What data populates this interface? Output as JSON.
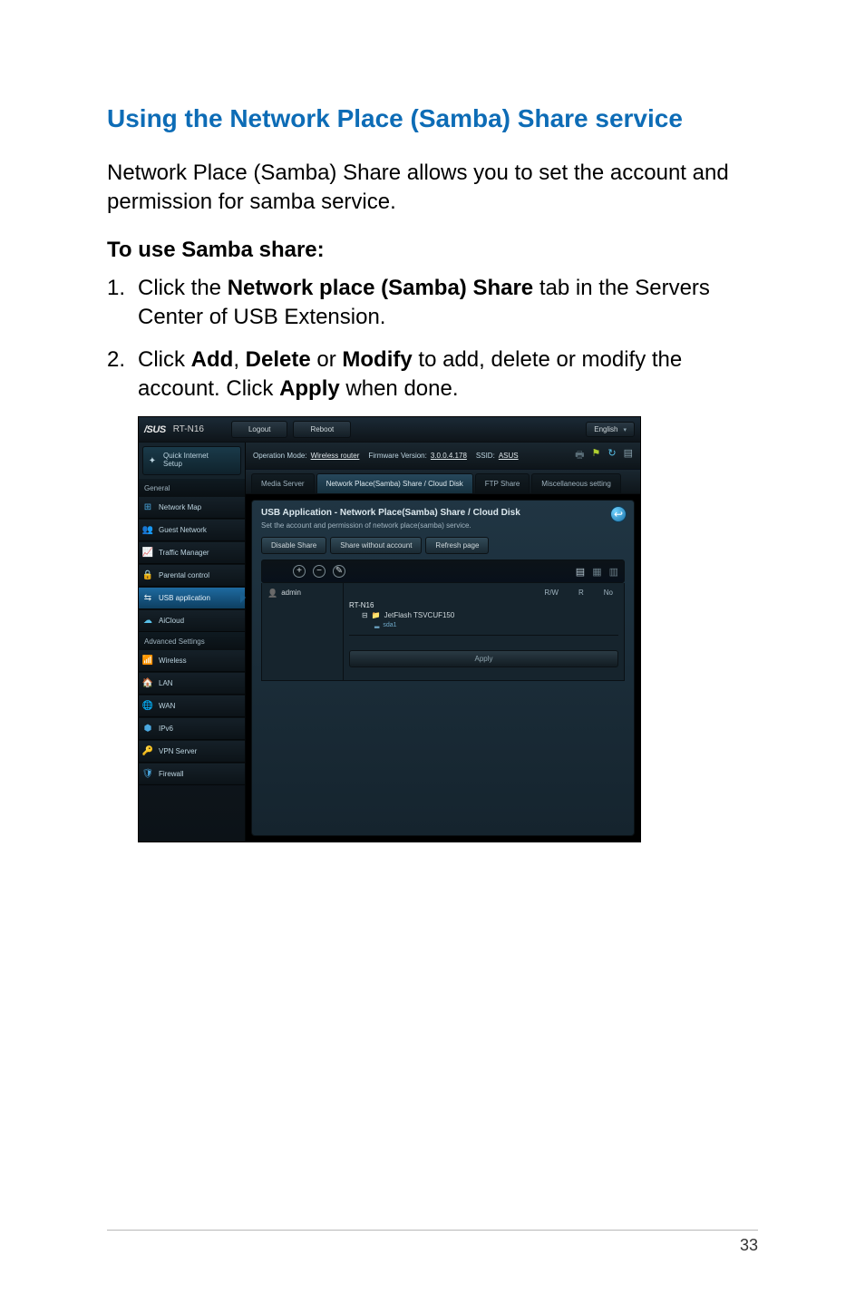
{
  "doc": {
    "section_title": "Using the Network Place (Samba) Share service",
    "intro": "Network Place (Samba) Share allows you to set the account and permission for samba service.",
    "subhead": "To use Samba share:",
    "step1_num": "1.",
    "step1_a": "Click the ",
    "step1_b": "Network place (Samba) Share",
    "step1_c": " tab in the Servers Center of USB Extension.",
    "step2_num": "2.",
    "step2_a": "Click ",
    "step2_add": "Add",
    "step2_comma1": ", ",
    "step2_del": "Delete",
    "step2_or": " or ",
    "step2_mod": "Modify",
    "step2_b": " to add, delete or modify the account. Click ",
    "step2_apply": "Apply",
    "step2_c": " when done.",
    "page_number": "33"
  },
  "ui": {
    "brand": "/SUS",
    "model": "RT-N16",
    "btn_logout": "Logout",
    "btn_reboot": "Reboot",
    "lang": "English",
    "info_opmode_label": "Operation Mode: ",
    "info_opmode_value": "Wireless router",
    "info_fw_label": "Firmware Version: ",
    "info_fw_value": "3.0.0.4.178",
    "info_ssid_label": "SSID: ",
    "info_ssid_value": "ASUS",
    "qis_l1": "Quick Internet",
    "qis_l2": "Setup",
    "hdr_general": "General",
    "nav_map": "Network Map",
    "nav_guest": "Guest Network",
    "nav_traffic": "Traffic Manager",
    "nav_parental": "Parental control",
    "nav_usb": "USB application",
    "nav_aicloud": "AiCloud",
    "hdr_adv": "Advanced Settings",
    "nav_wireless": "Wireless",
    "nav_lan": "LAN",
    "nav_wan": "WAN",
    "nav_ipv6": "IPv6",
    "nav_vpn": "VPN Server",
    "nav_fw": "Firewall",
    "tab_media": "Media Server",
    "tab_samba": "Network Place(Samba) Share / Cloud Disk",
    "tab_ftp": "FTP Share",
    "tab_misc": "Miscellaneous setting",
    "panel_title": "USB Application - Network Place(Samba) Share / Cloud Disk",
    "panel_sub": "Set the account and permission of network place(samba) service.",
    "btn_disable": "Disable Share",
    "btn_nowo": "Share without account",
    "btn_refresh": "Refresh page",
    "perm_rw": "R/W",
    "perm_r": "R",
    "perm_no": "No",
    "user_admin": "admin",
    "tree_root": "RT-N16",
    "tree_dev": "JetFlash TSVCUF150",
    "tree_sub": "sda1",
    "btn_apply": "Apply"
  }
}
